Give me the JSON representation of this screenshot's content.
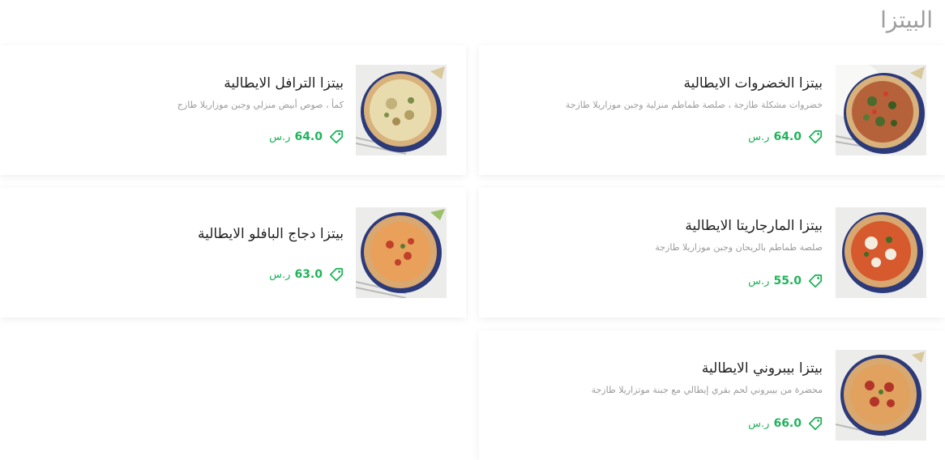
{
  "section": {
    "title": "البيتزا"
  },
  "items": [
    {
      "name": "بيتزا الخضروات الايطالية",
      "description": "خضروات مشكلة طازجة ، صلصة طماطم منزلية وجبن موزاريلا طازجة",
      "price": "64.0",
      "currency": "ر.س",
      "image": "vegetable-pizza-photo"
    },
    {
      "name": "بيتزا الترافل الايطالية",
      "description": "كمأ ، صوص أبيض منزلي وجبن موزاريلا طازج",
      "price": "64.0",
      "currency": "ر.س",
      "image": "truffle-pizza-photo"
    },
    {
      "name": "بيتزا المارجاريتا الايطالية",
      "description": "صلصة طماطم بالريحان وجبن موزاريلا طازجة",
      "price": "55.0",
      "currency": "ر.س",
      "image": "margherita-pizza-photo"
    },
    {
      "name": "بيتزا دجاج البافلو الايطالية",
      "description": "",
      "price": "63.0",
      "currency": "ر.س",
      "image": "buffalo-chicken-pizza-photo"
    },
    {
      "name": "بيتزا بيبروني الايطالية",
      "description": "محضرة من بيبروني لحم بقري إيطالي مع جبنة موتزاريلا طازجة",
      "price": "66.0",
      "currency": "ر.س",
      "image": "pepperoni-pizza-photo"
    }
  ],
  "colors": {
    "accent": "#1fb35a",
    "title": "#9e9e9e",
    "text": "#222222",
    "muted": "#9a9a9a"
  },
  "icons": {
    "price_tag": "price-tag-icon"
  }
}
